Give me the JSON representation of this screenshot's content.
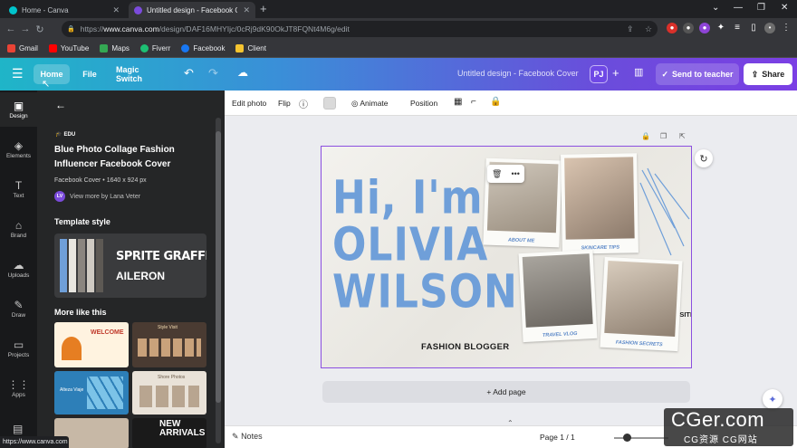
{
  "browser": {
    "tabs": [
      {
        "title": "Home - Canva",
        "active": false
      },
      {
        "title": "Untitled design - Facebook Cove",
        "active": true
      }
    ],
    "url_prefix": "https://",
    "url_domain": "www.canva.com",
    "url_path": "/design/DAF16MHYIjc/0cRj9dK90OkJT8FQNt4M6g/edit",
    "bookmarks": [
      "Gmail",
      "YouTube",
      "Maps",
      "Fiverr",
      "Facebook",
      "Client"
    ],
    "status_url": "https://www.canva.com"
  },
  "header": {
    "home": "Home",
    "file": "File",
    "magic_switch": "Magic Switch",
    "title": "Untitled design - Facebook Cover",
    "avatar": "PJ",
    "send_to_teacher": "Send to teacher",
    "share": "Share"
  },
  "rail": [
    "Design",
    "Elements",
    "Text",
    "Brand",
    "Uploads",
    "Draw",
    "Projects",
    "Apps"
  ],
  "panel": {
    "badge": "EDU",
    "title": "Blue Photo Collage Fashion Influencer Facebook Cover",
    "meta": "Facebook Cover • 1640 x 924 px",
    "author_initials": "LV",
    "author": "View more by Lana Veter",
    "template_style": "Template style",
    "font_primary": "SPRITE GRAFFITI",
    "font_secondary": "AILERON",
    "more_like_this": "More like this",
    "thumb_text": [
      "WELCOME",
      "Style Visit",
      "Alteza Viaje",
      "Shore Photos",
      "NEW ARRIVALS"
    ]
  },
  "toolbar": {
    "edit_photo": "Edit photo",
    "flip": "Flip",
    "animate": "Animate",
    "position": "Position"
  },
  "design": {
    "line1": "Hi, I'm",
    "line2": "OLIVIA",
    "line3": "WILSON.",
    "subtitle": "FASHION BLOGGER",
    "handle": "@REALLYGREATSITE",
    "captions": [
      "ABOUT ME",
      "SKINCARE TIPS",
      "TRAVEL VLOG",
      "FASHION SECRETS"
    ],
    "accent": "#6f9fd9"
  },
  "add_page": "+ Add page",
  "bottom": {
    "notes": "Notes",
    "page": "Page 1 / 1"
  },
  "watermark": {
    "main": "CGer.com",
    "sub": "CG资源 CG网站"
  }
}
